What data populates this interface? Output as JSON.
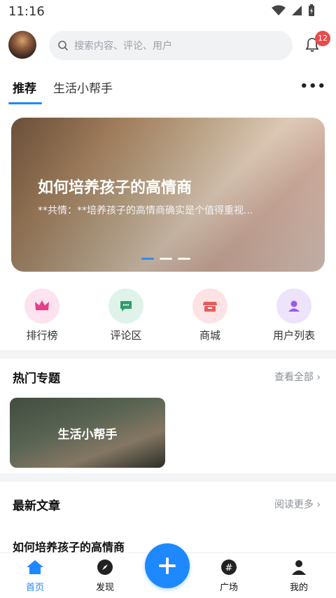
{
  "status": {
    "time": "11:16"
  },
  "search": {
    "placeholder": "搜索内容、评论、用户"
  },
  "notifications": {
    "count": "12"
  },
  "tabs": [
    {
      "label": "推荐"
    },
    {
      "label": "生活小帮手"
    }
  ],
  "banner": {
    "title": "如何培养孩子的高情商",
    "subtitle": "**共情：**培养孩子的高情商确实是个值得重视..."
  },
  "quick_actions": [
    {
      "label": "排行榜",
      "icon": "crown-icon",
      "bg": "#fde3ef",
      "color": "#e83e8c"
    },
    {
      "label": "评论区",
      "icon": "comment-icon",
      "bg": "#dff3ea",
      "color": "#2e9d6b"
    },
    {
      "label": "商城",
      "icon": "shop-icon",
      "bg": "#fde3e3",
      "color": "#e85b5b"
    },
    {
      "label": "用户列表",
      "icon": "user-icon",
      "bg": "#ede3fb",
      "color": "#9b59e8"
    }
  ],
  "hot_topics": {
    "title": "热门专题",
    "more": "查看全部",
    "items": [
      {
        "label": "生活小帮手"
      }
    ]
  },
  "latest": {
    "title": "最新文章",
    "more": "阅读更多",
    "first_article": "如何培养孩子的高情商"
  },
  "bottom_nav": [
    {
      "label": "首页",
      "icon": "home-icon"
    },
    {
      "label": "发现",
      "icon": "compass-icon"
    },
    {
      "label": "广场",
      "icon": "hashtag-icon"
    },
    {
      "label": "我的",
      "icon": "profile-icon"
    }
  ],
  "colors": {
    "accent": "#1e88ff",
    "badge": "#e94b4b"
  }
}
